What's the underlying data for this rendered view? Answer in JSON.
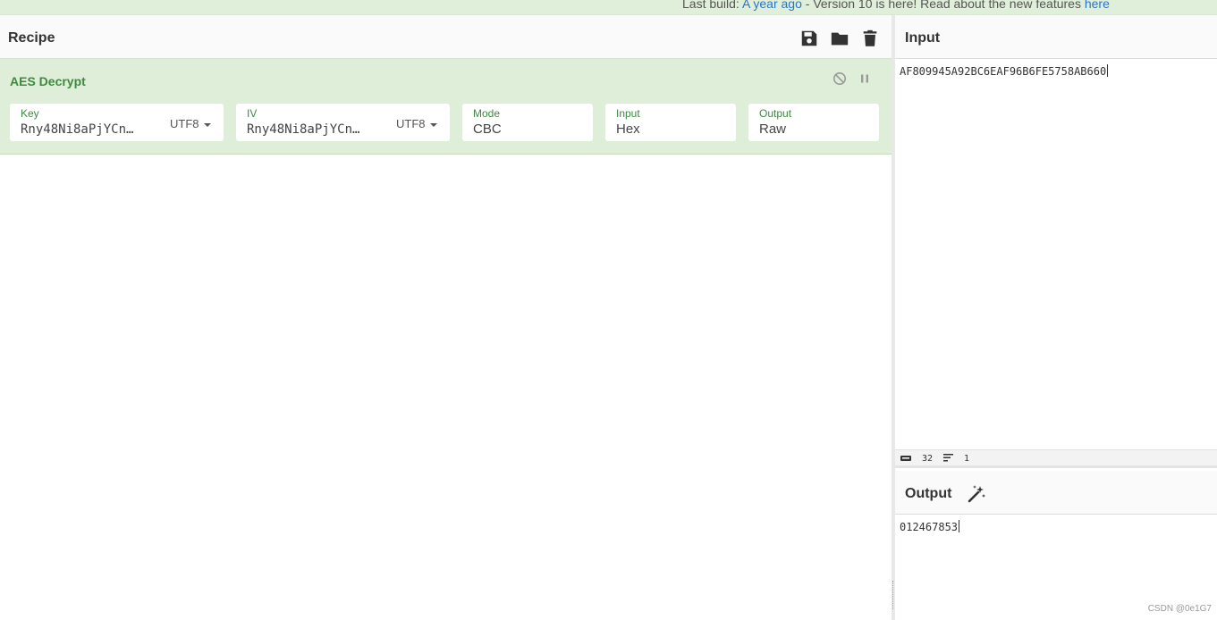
{
  "banner": {
    "prefix": "Last build: ",
    "build_age": "A year ago",
    "message": " - Version 10 is here! Read about the new features ",
    "link": "here"
  },
  "recipe": {
    "title": "Recipe",
    "icons": {
      "save": "save-icon",
      "load": "folder-icon",
      "clear": "trash-icon"
    },
    "operation": {
      "name": "AES Decrypt",
      "args": {
        "key": {
          "label": "Key",
          "value": "Rny48Ni8aPjYCn…",
          "encoding": "UTF8"
        },
        "iv": {
          "label": "IV",
          "value": "Rny48Ni8aPjYCn…",
          "encoding": "UTF8"
        },
        "mode": {
          "label": "Mode",
          "value": "CBC"
        },
        "input": {
          "label": "Input",
          "value": "Hex"
        },
        "output": {
          "label": "Output",
          "value": "Raw"
        }
      }
    }
  },
  "input": {
    "title": "Input",
    "text": "AF809945A92BC6EAF96B6FE5758AB660",
    "stats": {
      "length": "32",
      "lines": "1"
    }
  },
  "output": {
    "title": "Output",
    "text": "012467853"
  },
  "watermark": "CSDN @0e1G7",
  "colors": {
    "accent_green": "#3c8a3f",
    "operation_bg": "#dfeed8",
    "link_blue": "#2a74c9"
  }
}
